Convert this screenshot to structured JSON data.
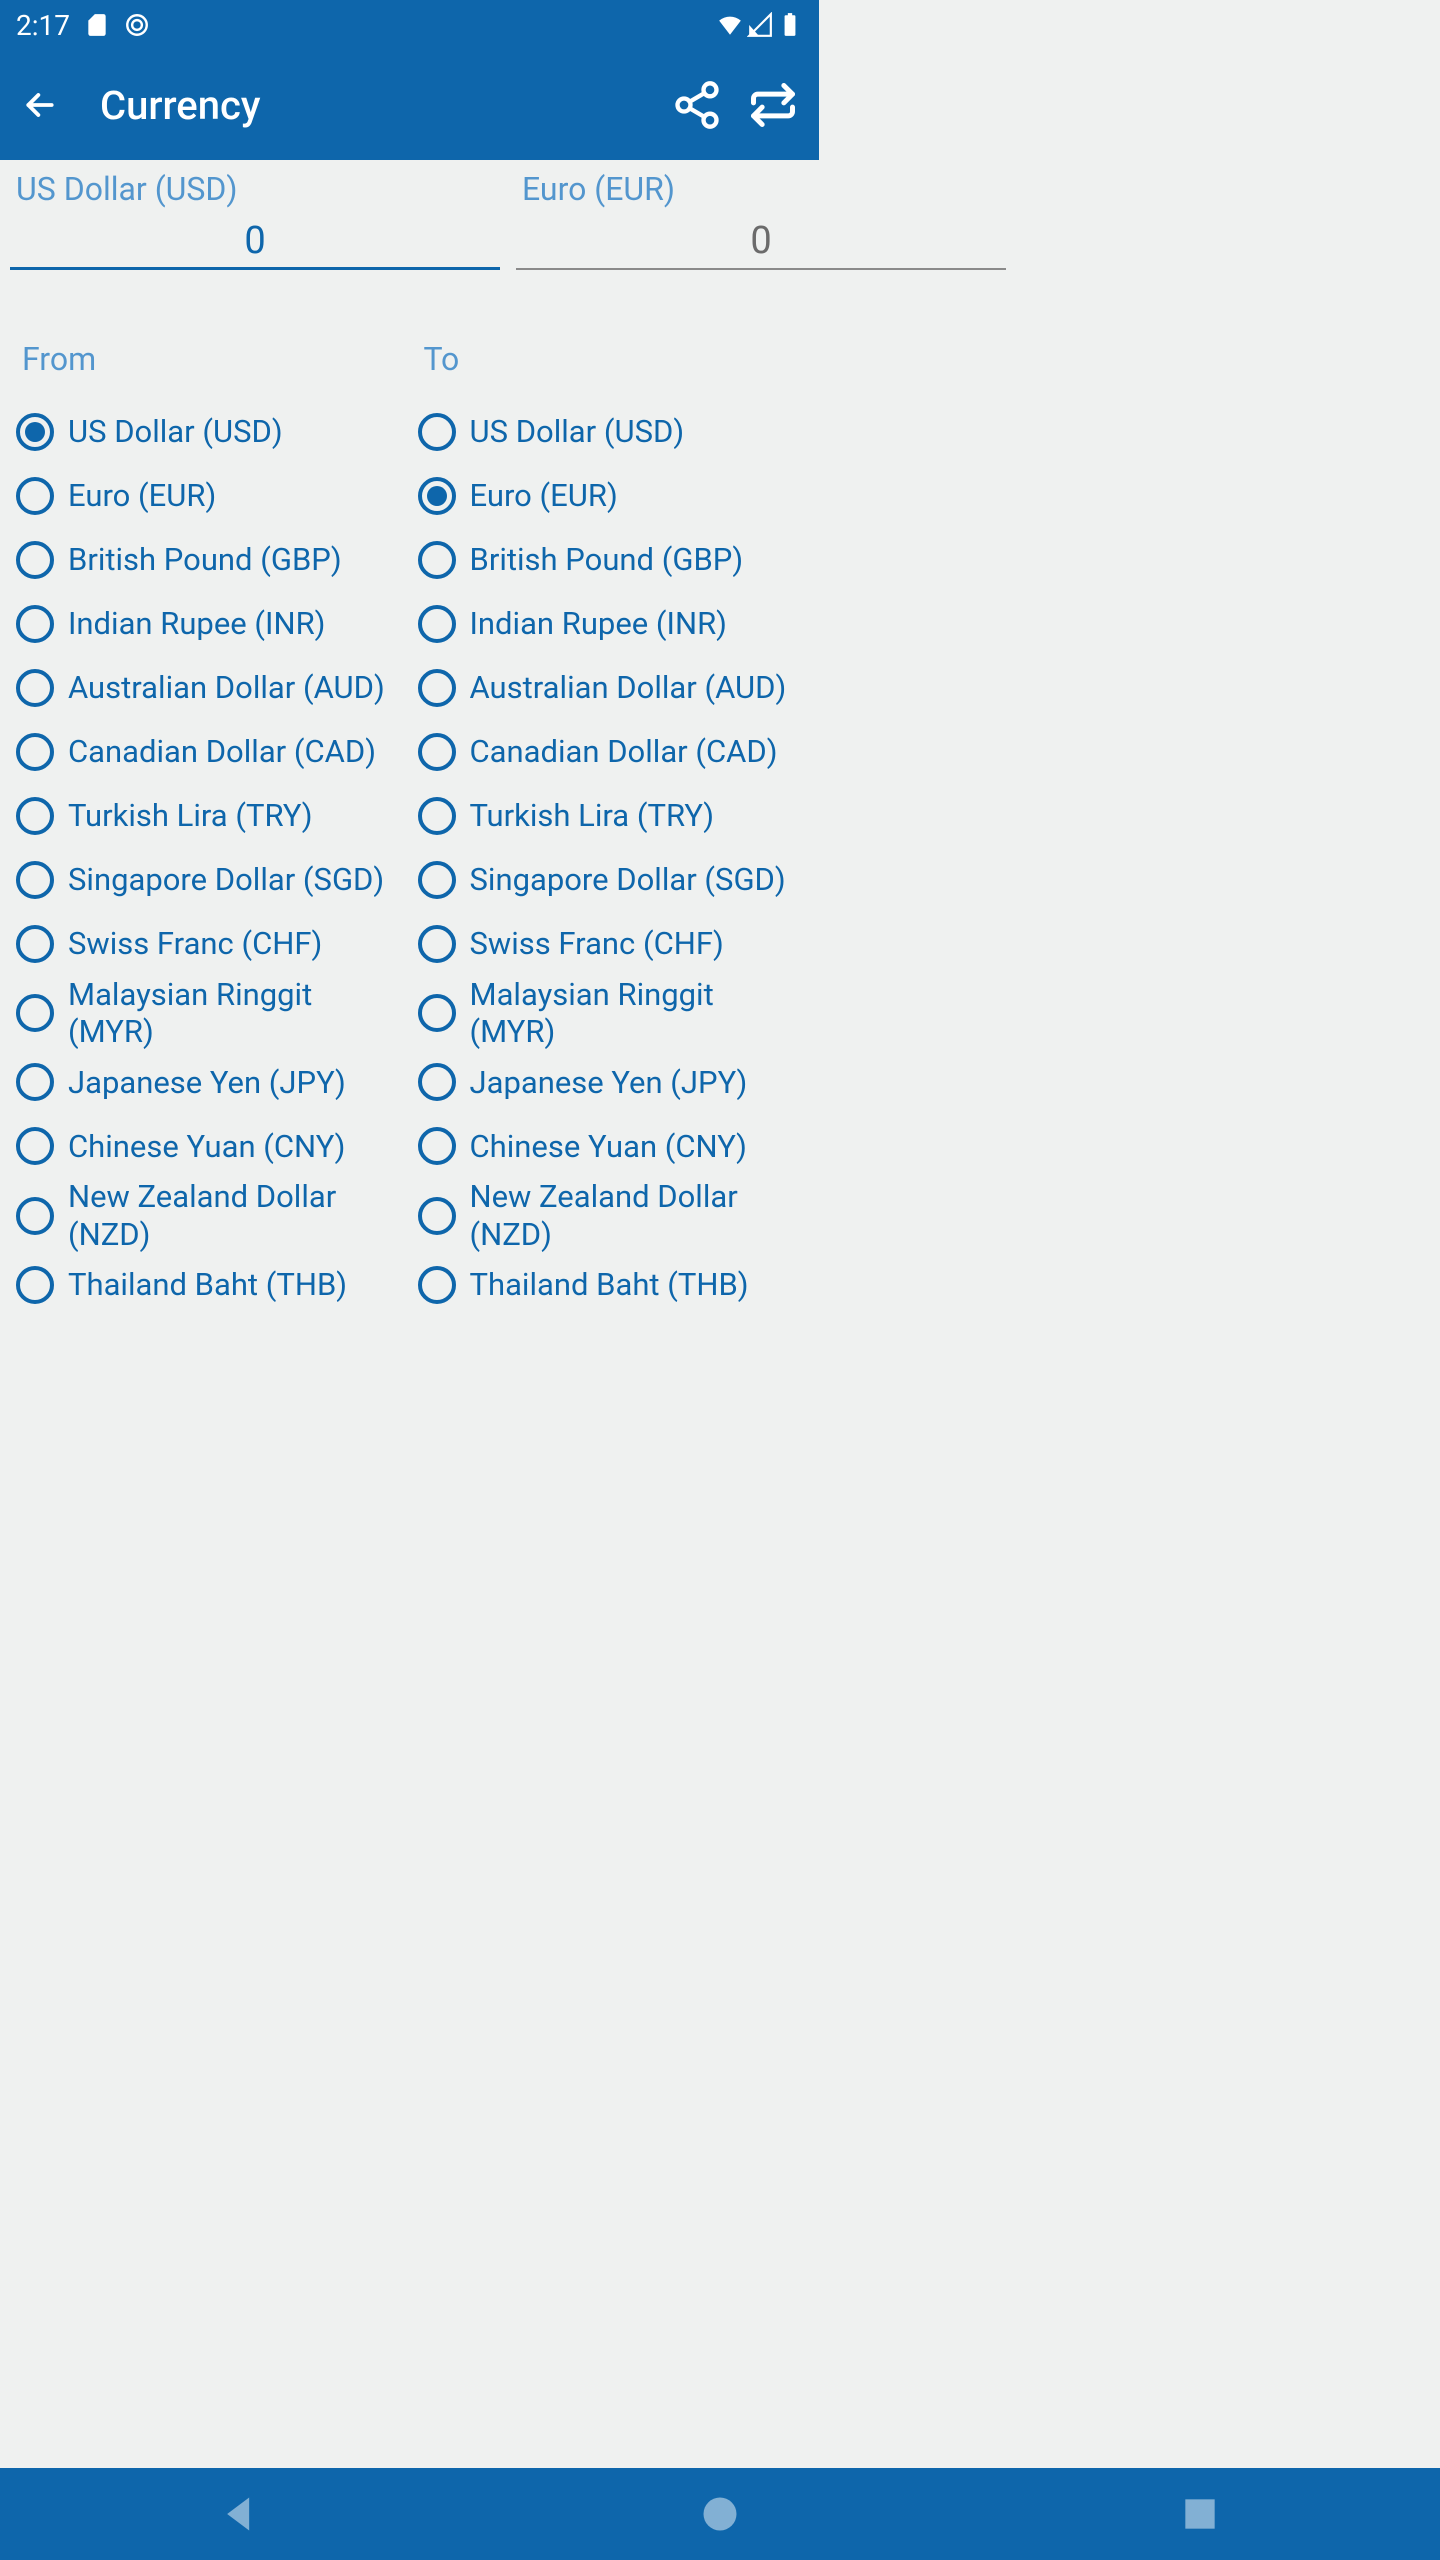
{
  "status": {
    "time": "2:17"
  },
  "appbar": {
    "title": "Currency"
  },
  "inputs": {
    "from": {
      "label": "US Dollar (USD)",
      "value": "0"
    },
    "to": {
      "label": "Euro (EUR)",
      "value": "0"
    }
  },
  "lists": {
    "from_header": "From",
    "to_header": "To",
    "options": [
      "US Dollar (USD)",
      "Euro (EUR)",
      "British Pound (GBP)",
      "Indian Rupee (INR)",
      "Australian Dollar (AUD)",
      "Canadian Dollar (CAD)",
      "Turkish Lira (TRY)",
      "Singapore Dollar (SGD)",
      "Swiss Franc (CHF)",
      "Malaysian Ringgit (MYR)",
      "Japanese Yen (JPY)",
      "Chinese Yuan (CNY)",
      "New Zealand Dollar (NZD)",
      "Thailand Baht (THB)"
    ],
    "from_selected": 0,
    "to_selected": 1
  }
}
